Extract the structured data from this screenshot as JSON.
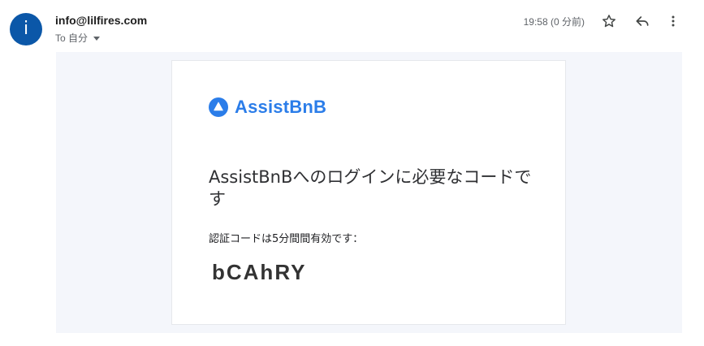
{
  "header": {
    "avatar_letter": "i",
    "sender": "info@lilfires.com",
    "to_label": "To 自分",
    "timestamp": "19:58 (0 分前)"
  },
  "icons": {
    "star": "star-icon",
    "reply": "reply-icon",
    "more": "more-vert-icon",
    "logo": "triangle-logo-icon"
  },
  "email": {
    "brand_name": "AssistBnB",
    "headline": "AssistBnBへのログインに必要なコードです",
    "validity_note": "認証コードは5分間間有効です：",
    "code": "bCAhRY"
  },
  "colors": {
    "avatar": "#0b57a8",
    "brand": "#2b7de9",
    "outer_bg": "#f4f6fb"
  }
}
